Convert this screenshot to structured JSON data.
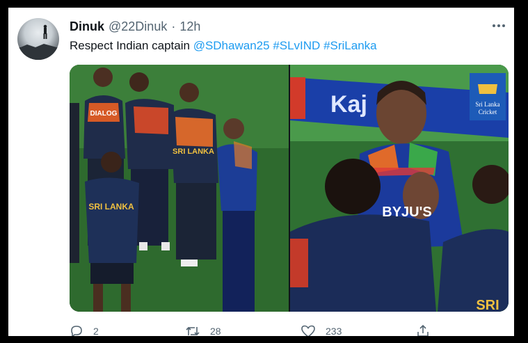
{
  "tweet": {
    "author_name": "Dinuk",
    "handle": "@22Dinuk",
    "separator": "·",
    "time": "12h",
    "text_prefix": "Respect Indian captain",
    "mention": "@SDhawan25",
    "hashtags": [
      "#SLvIND",
      "#SriLanka"
    ]
  },
  "media": {
    "left_photo": {
      "jersey_texts": [
        "DIALOG",
        "SRI LANKA",
        "SRI LANKA"
      ]
    },
    "right_photo": {
      "jersey_texts": [
        "BYJU'S",
        "SRI"
      ],
      "board_text": "Kaj",
      "logo_text": [
        "Sri Lanka",
        "Cricket"
      ]
    }
  },
  "actions": {
    "reply_count": "2",
    "retweet_count": "28",
    "like_count": "233"
  },
  "icons": [
    "reply-icon",
    "retweet-icon",
    "like-icon",
    "share-icon",
    "more-icon"
  ],
  "colors": {
    "link": "#1d9bf0",
    "text": "#0f1419",
    "muted": "#536471"
  }
}
